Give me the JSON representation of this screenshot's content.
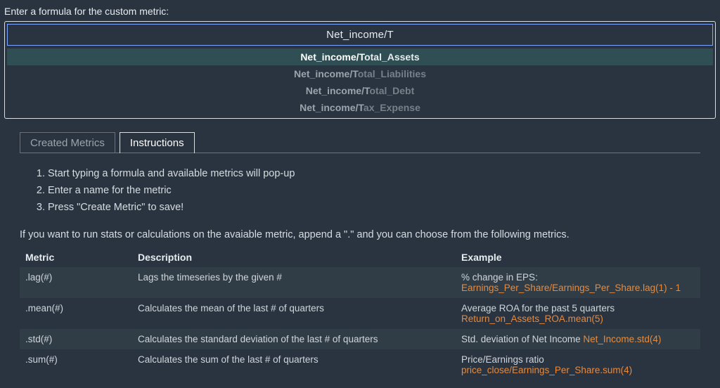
{
  "label": "Enter a formula for the custom metric:",
  "input_value": "Net_income/T",
  "typed_prefix": "Net_income/T",
  "suggestions": [
    {
      "rest": "otal_Assets",
      "selected": true
    },
    {
      "rest": "otal_Liabilities",
      "selected": false
    },
    {
      "rest": "otal_Debt",
      "selected": false
    },
    {
      "rest": "ax_Expense",
      "selected": false
    }
  ],
  "tabs": [
    {
      "label": "Created Metrics",
      "active": false
    },
    {
      "label": "Instructions",
      "active": true
    }
  ],
  "steps": [
    "Start typing a formula and available metrics will pop-up",
    "Enter a name for the metric",
    "Press \"Create Metric\" to save!"
  ],
  "note": "If you want to run stats or calculations on the avaiable metric, append a \".\" and you can choose from the following metrics.",
  "table": {
    "headers": {
      "metric": "Metric",
      "description": "Description",
      "example": "Example"
    },
    "rows": [
      {
        "metric": ".lag(#)",
        "description": "Lags the timeseries by the given #",
        "example_label": "% change in EPS:",
        "example_break": true,
        "example_code": "Earnings_Per_Share/Earnings_Per_Share.lag(1) - 1"
      },
      {
        "metric": ".mean(#)",
        "description": "Calculates the mean of the last # of quarters",
        "example_label": "Average ROA for the past 5 quarters",
        "example_break": true,
        "example_code": "Return_on_Assets_ROA.mean(5)"
      },
      {
        "metric": ".std(#)",
        "description": "Calculates the standard deviation of the last # of quarters",
        "example_label": "Std. deviation of Net Income ",
        "example_break": false,
        "example_code": "Net_Income.std(4)"
      },
      {
        "metric": ".sum(#)",
        "description": "Calculates the sum of the last # of quarters",
        "example_label": "Price/Earnings ratio",
        "example_break": true,
        "example_code": "price_close/Earnings_Per_Share.sum(4)"
      }
    ]
  }
}
